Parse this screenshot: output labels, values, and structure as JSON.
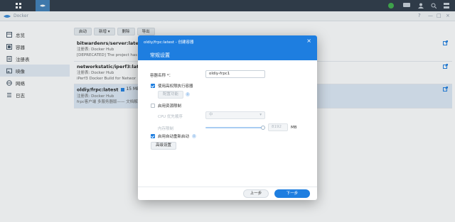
{
  "window": {
    "title": "Docker"
  },
  "sidebar": {
    "items": [
      {
        "label": "总览",
        "icon": "overview-icon"
      },
      {
        "label": "容器",
        "icon": "container-icon"
      },
      {
        "label": "注册表",
        "icon": "registry-icon"
      },
      {
        "label": "映像",
        "icon": "image-icon",
        "active": true
      },
      {
        "label": "网络",
        "icon": "network-icon"
      },
      {
        "label": "日志",
        "icon": "log-icon"
      }
    ]
  },
  "toolbar": {
    "launch": "启动",
    "add": "新增",
    "delete": "删除",
    "export": "导出"
  },
  "images": [
    {
      "name": "bitwardenrs/server:latest",
      "registry": "注册表: Docker Hub",
      "desc": "[DEPRECATED] The project has"
    },
    {
      "name": "networkstatic/iperf3:latest",
      "registry": "注册表: Docker Hub",
      "desc": "iPerf3 Docker Build for Networ"
    },
    {
      "name": "oldiy/frpc:latest",
      "size": "15 MB",
      "registry": "注册表: Docker Hub",
      "desc": "frpc客户端 多服务器版—— 文档解"
    }
  ],
  "dialog": {
    "breadcrumb": "oldiy/frpc:latest - 创建容器",
    "title": "常规设置",
    "container_name_label": "容器名称 *：",
    "container_name_value": "oldiy-frpc1",
    "privileged_label": "使用高权限执行容器",
    "advanced_btn": "配置功能",
    "resource_limit_label": "启用资源限制",
    "cpu_label": "CPU 优先顺序",
    "cpu_value": "中",
    "memory_label": "内存限制",
    "memory_value": "8192",
    "memory_unit": "MB",
    "auto_restart_label": "启用自动重新启动",
    "advanced_settings_btn": "高级设置",
    "prev_btn": "上一步",
    "next_btn": "下一步"
  },
  "colors": {
    "accent": "#1e7ee0",
    "taskbar": "#2e3a47"
  }
}
